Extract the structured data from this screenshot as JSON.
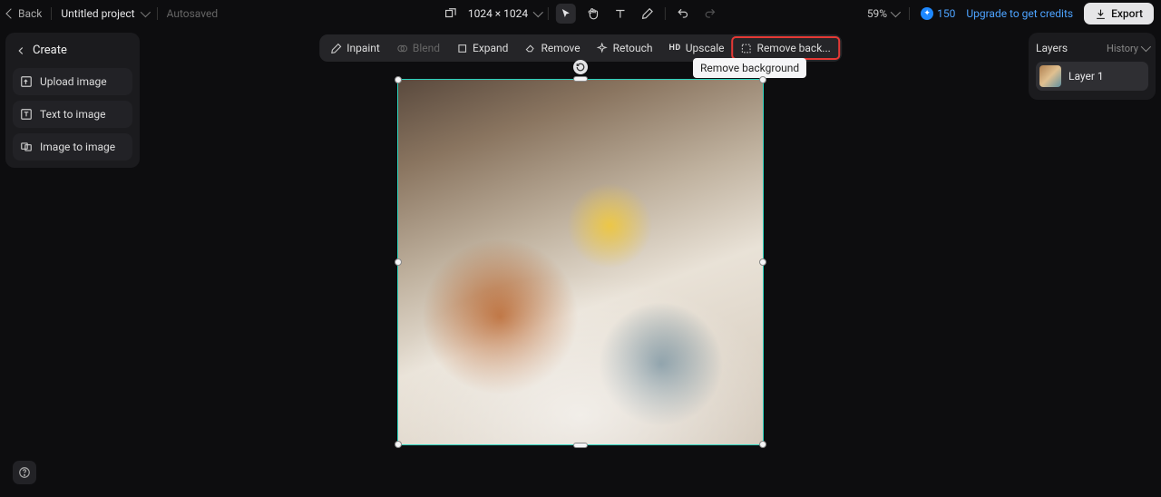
{
  "header": {
    "back_label": "Back",
    "project_name": "Untitled project",
    "autosaved_label": "Autosaved",
    "canvas_dimensions": "1024 × 1024",
    "zoom_level": "59%",
    "credits": "150",
    "upgrade_label": "Upgrade to get credits",
    "export_label": "Export"
  },
  "create_panel": {
    "title": "Create",
    "items": [
      "Upload image",
      "Text to image",
      "Image to image"
    ]
  },
  "image_toolbar": {
    "inpaint": "Inpaint",
    "blend": "Blend",
    "expand": "Expand",
    "remove": "Remove",
    "retouch": "Retouch",
    "upscale": "Upscale",
    "remove_bg_short": "Remove back...",
    "remove_bg_tooltip": "Remove background"
  },
  "layers_panel": {
    "title": "Layers",
    "history_label": "History",
    "layers": [
      {
        "name": "Layer 1"
      }
    ]
  },
  "highlight": {
    "target": "remove-background-button"
  }
}
